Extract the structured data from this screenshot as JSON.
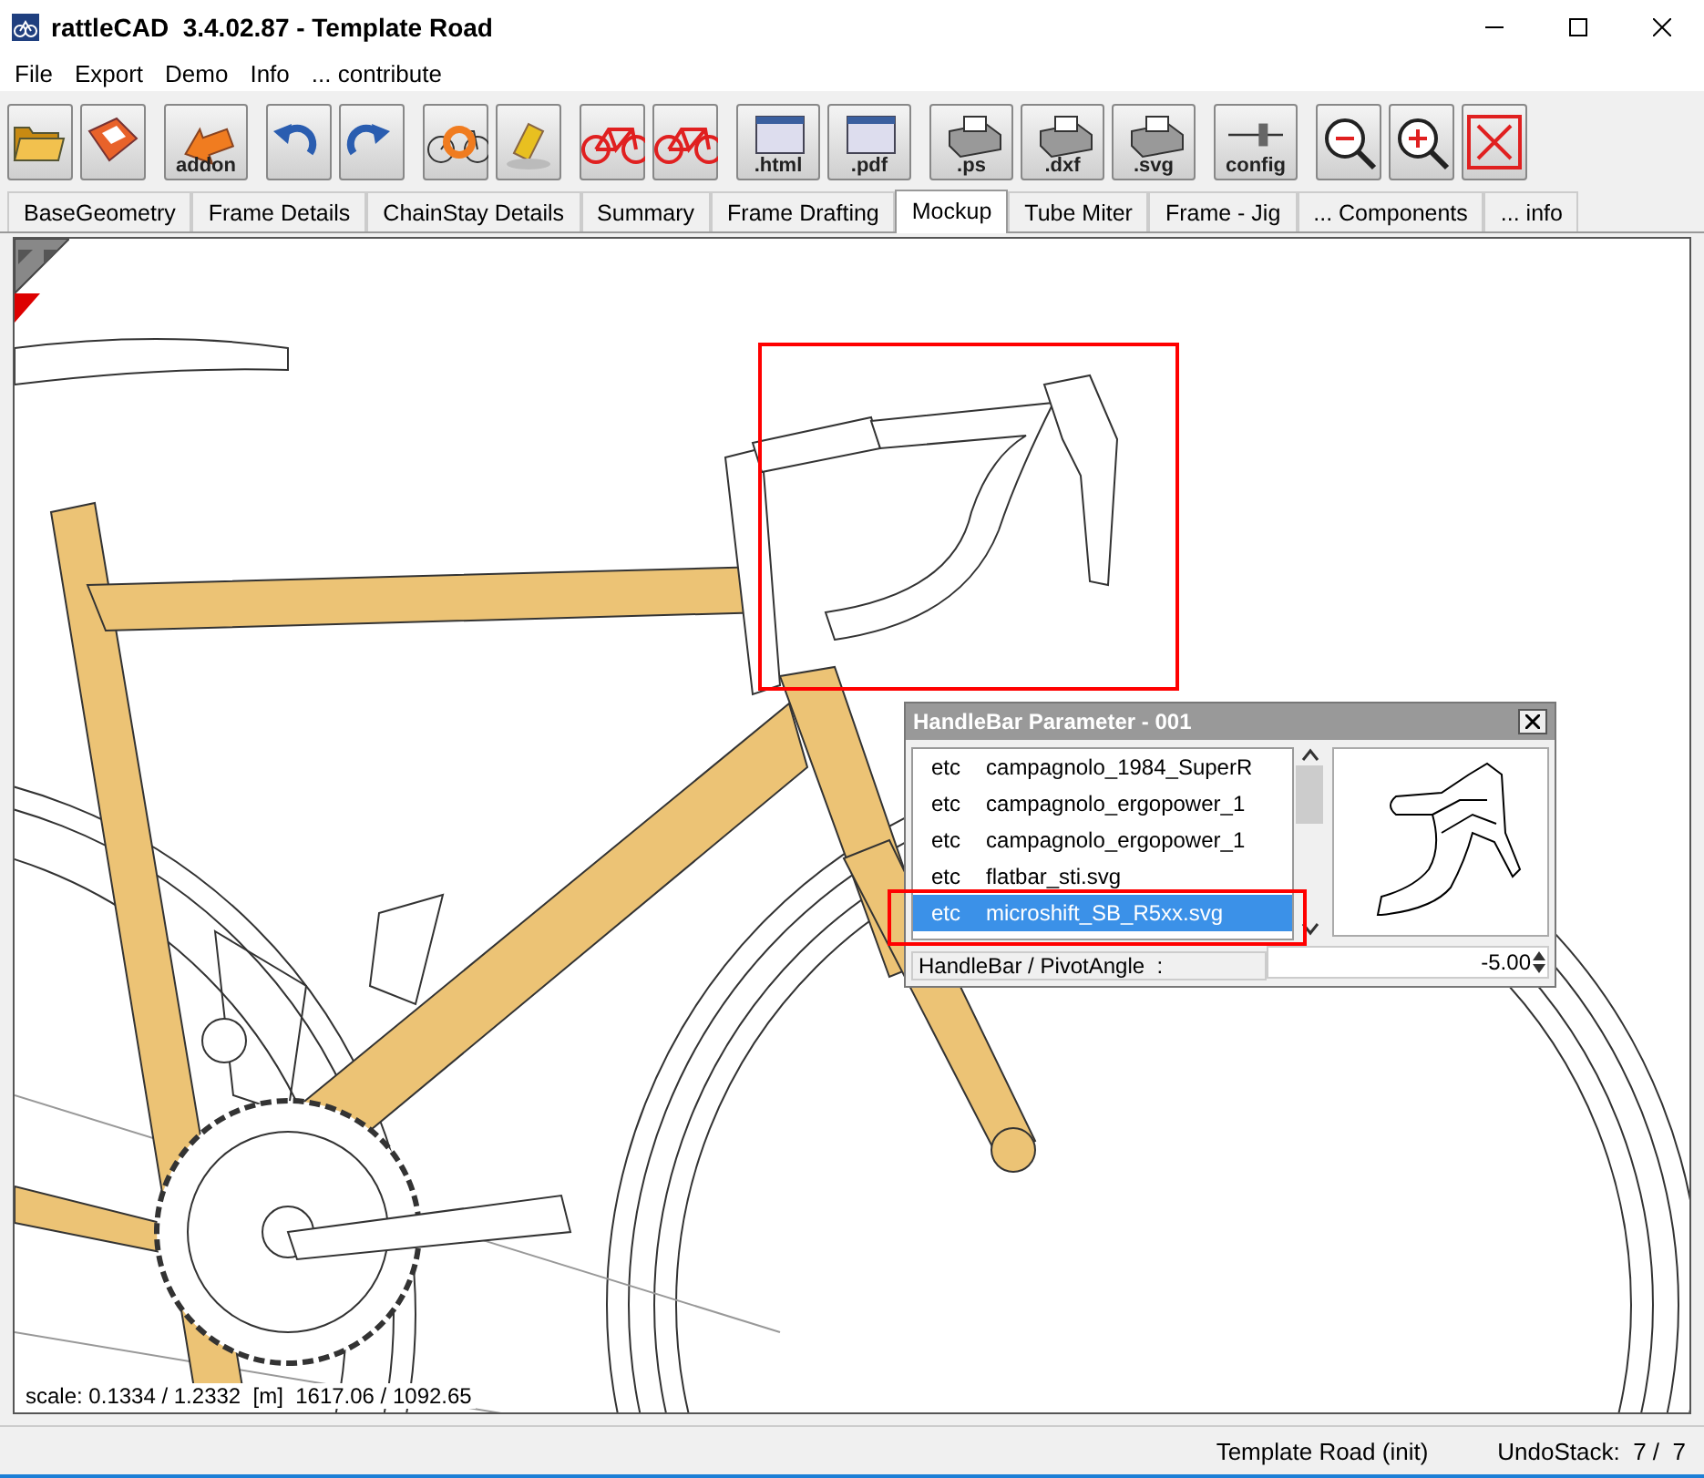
{
  "window": {
    "title": "rattleCAD  3.4.02.87 - Template Road"
  },
  "menu": [
    "File",
    "Export",
    "Demo",
    "Info",
    "... contribute"
  ],
  "toolbar": [
    [
      {
        "kind": "open"
      },
      {
        "kind": "save"
      }
    ],
    [
      {
        "kind": "addon",
        "label": "addon"
      }
    ],
    [
      {
        "kind": "undo"
      },
      {
        "kind": "redo"
      }
    ],
    [
      {
        "kind": "render"
      },
      {
        "kind": "eraser"
      }
    ],
    [
      {
        "kind": "bike"
      },
      {
        "kind": "bike"
      }
    ],
    [
      {
        "kind": "doc",
        "label": ".html"
      },
      {
        "kind": "doc",
        "label": ".pdf"
      }
    ],
    [
      {
        "kind": "printer",
        "label": ".ps"
      },
      {
        "kind": "printer",
        "label": ".dxf"
      },
      {
        "kind": "printer",
        "label": ".svg"
      }
    ],
    [
      {
        "kind": "slider",
        "label": "config"
      }
    ],
    [
      {
        "kind": "zoom-out"
      },
      {
        "kind": "zoom-in"
      },
      {
        "kind": "fit"
      }
    ]
  ],
  "tabs": [
    {
      "label": "BaseGeometry",
      "selected": false
    },
    {
      "label": "Frame Details",
      "selected": false
    },
    {
      "label": "ChainStay Details",
      "selected": false
    },
    {
      "label": "Summary",
      "selected": false
    },
    {
      "label": "Frame Drafting",
      "selected": false
    },
    {
      "label": "Mockup",
      "selected": true
    },
    {
      "label": "Tube Miter",
      "selected": false
    },
    {
      "label": "Frame - Jig",
      "selected": false
    },
    {
      "label": "... Components",
      "selected": false
    },
    {
      "label": "... info",
      "selected": false
    }
  ],
  "canvas": {
    "readout": "scale: 0.1334 / 1.2332  [m]  1617.06 / 1092.65"
  },
  "dialog": {
    "title": "HandleBar Parameter - 001",
    "rows": [
      {
        "group": "etc",
        "file": "campagnolo_1984_SuperR",
        "selected": false
      },
      {
        "group": "etc",
        "file": "campagnolo_ergopower_1",
        "selected": false
      },
      {
        "group": "etc",
        "file": "campagnolo_ergopower_1",
        "selected": false
      },
      {
        "group": "etc",
        "file": "flatbar_sti.svg",
        "selected": false
      },
      {
        "group": "etc",
        "file": "microshift_SB_R5xx.svg",
        "selected": true
      }
    ],
    "parameter": {
      "label": "HandleBar / PivotAngle  :",
      "value": "-5.00"
    }
  },
  "status_bar": {
    "project": "Template Road (init)",
    "undo": "UndoStack:  7 /  7"
  }
}
